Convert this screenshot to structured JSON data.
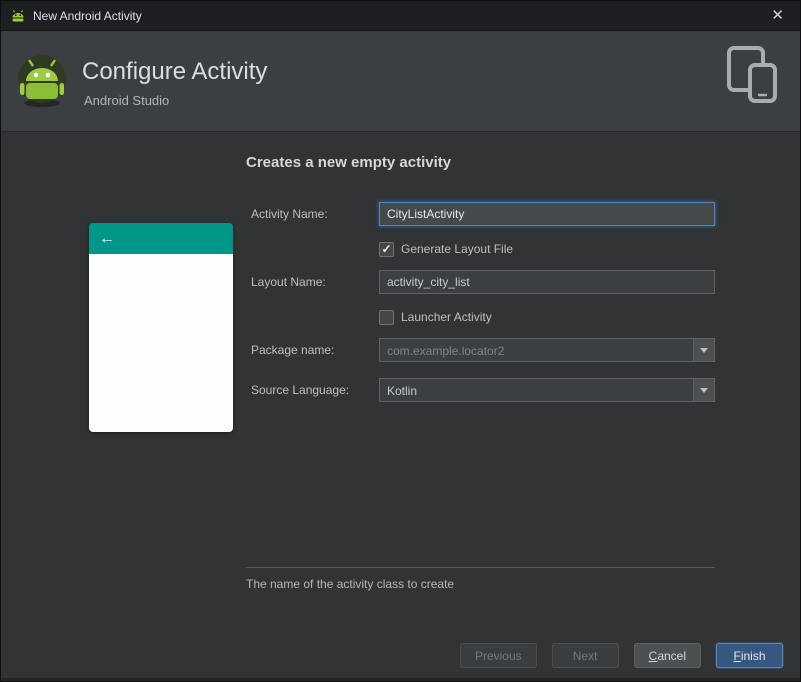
{
  "window": {
    "title": "New Android Activity",
    "close_glyph": "✕"
  },
  "header": {
    "title": "Configure Activity",
    "subtitle": "Android Studio"
  },
  "content": {
    "heading": "Creates a new empty activity",
    "preview": {
      "back_glyph": "←"
    },
    "form": {
      "activity_name_label": "Activity Name:",
      "activity_name_value": "CityListActivity",
      "generate_layout_label": "Generate Layout File",
      "generate_layout_checked": "✓",
      "layout_name_label": "Layout Name:",
      "layout_name_value": "activity_city_list",
      "launcher_label": "Launcher Activity",
      "package_label": "Package name:",
      "package_value": "com.example.locator2",
      "language_label": "Source Language:",
      "language_value": "Kotlin"
    },
    "helper_text": "The name of the activity class to create"
  },
  "footer": {
    "previous": "Previous",
    "next": "Next",
    "cancel_mnemonic": "C",
    "cancel_rest": "ancel",
    "finish_mnemonic": "F",
    "finish_rest": "inish"
  },
  "colors": {
    "accent_focus_blue": "#4a88c7",
    "preview_appbar_teal": "#009688",
    "finish_button_blue": "#365880",
    "android_green": "#9ccc3f",
    "dialog_background": "#313335",
    "header_background": "#3c3f41",
    "titlebar_background": "#1e1f22"
  }
}
